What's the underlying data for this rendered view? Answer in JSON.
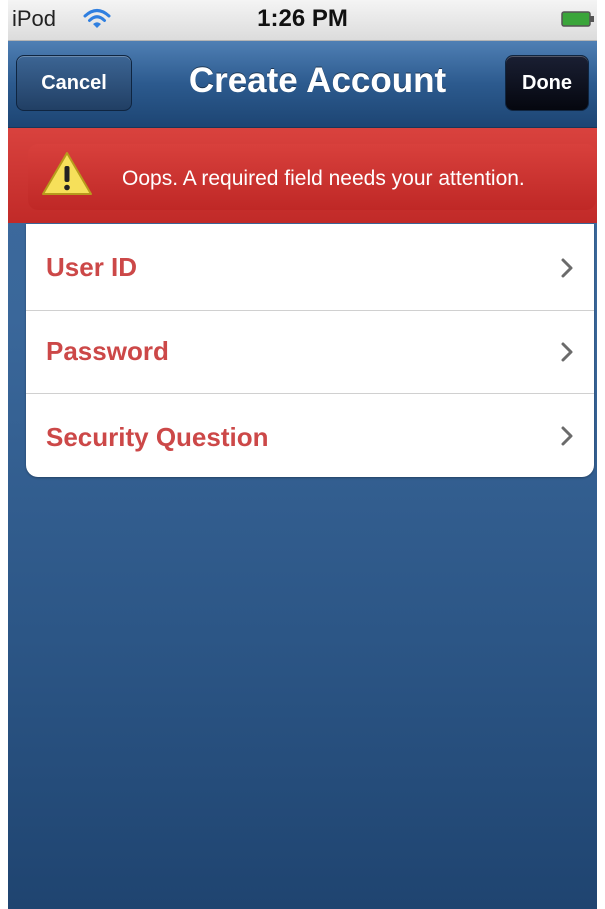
{
  "status_bar": {
    "carrier": "iPod",
    "time": "1:26 PM",
    "wifi_icon": "wifi-icon",
    "battery_icon": "battery-icon"
  },
  "nav_bar": {
    "title": "Create Account",
    "cancel_label": "Cancel",
    "done_label": "Done",
    "color": "#2c5a8e"
  },
  "error_banner": {
    "message": "Oops. A required field needs your attention.",
    "icon": "warning-icon",
    "color": "#c12a28"
  },
  "form": {
    "rows": [
      {
        "label": "User ID",
        "icon": "chevron-right-icon"
      },
      {
        "label": "Password",
        "icon": "chevron-right-icon"
      },
      {
        "label": "Security Question",
        "icon": "chevron-right-icon"
      }
    ],
    "label_color": "#cc4848"
  }
}
